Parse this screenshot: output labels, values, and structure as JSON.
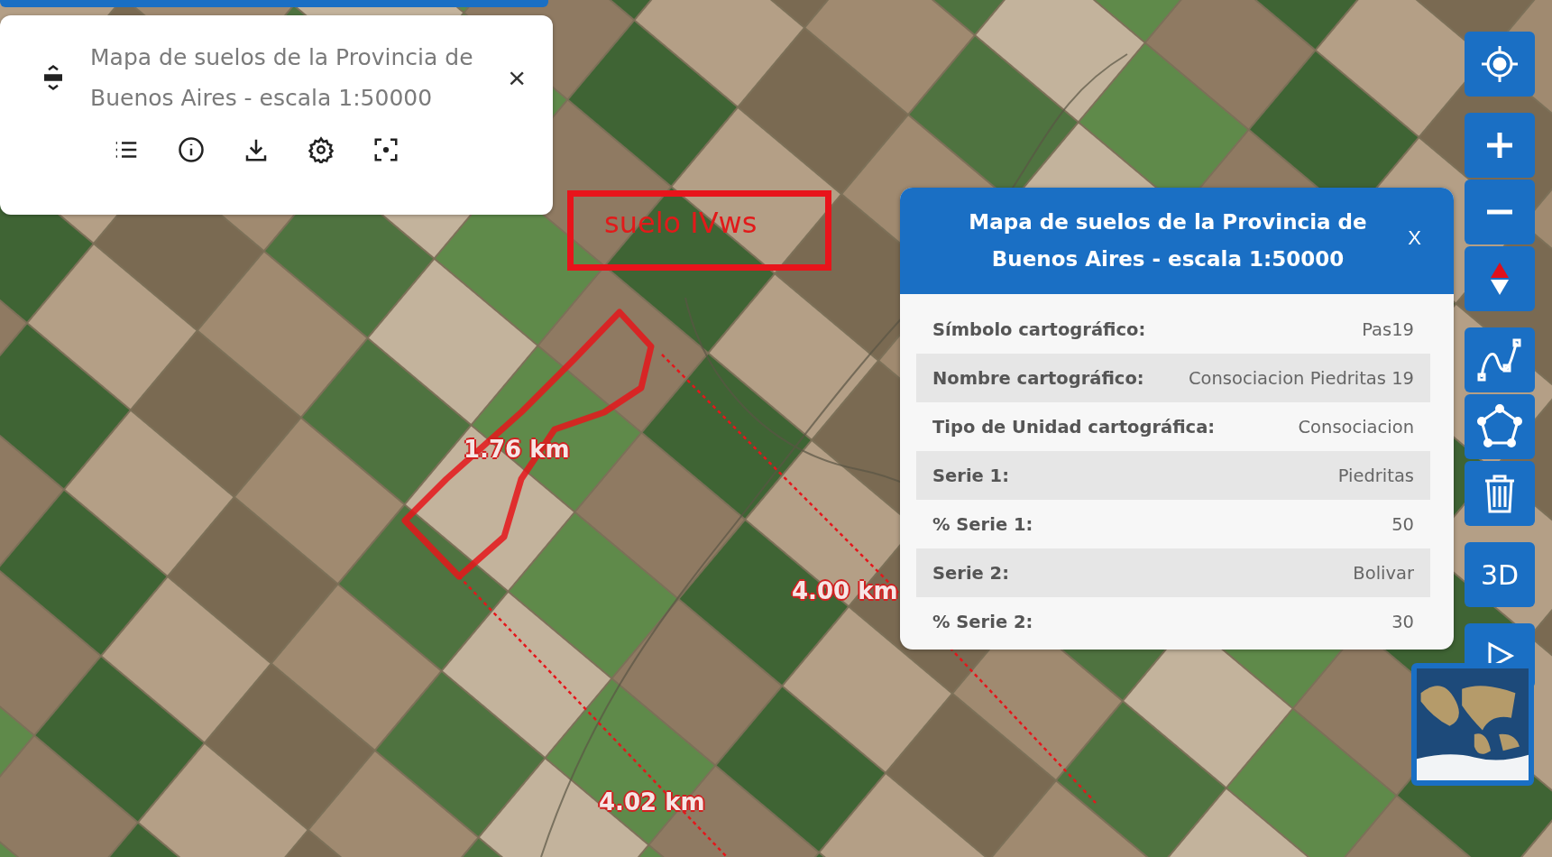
{
  "layer_panel": {
    "title": "Mapa de suelos de la Provincia de Buenos Aires - escala 1:50000",
    "close": "×"
  },
  "annotation": {
    "label": "suelo IVws"
  },
  "measurements": [
    {
      "text": "1.76 km"
    },
    {
      "text": "4.00 km"
    },
    {
      "text": "4.02 km"
    }
  ],
  "feature_popup": {
    "title": "Mapa de suelos de la Provincia de Buenos Aires - escala 1:50000",
    "close": "X",
    "rows": [
      {
        "label": "Símbolo cartográfico:",
        "value": "Pas19"
      },
      {
        "label": "Nombre cartográfico:",
        "value": "Consociacion Piedritas 19"
      },
      {
        "label": "Tipo de Unidad cartográfica:",
        "value": "Consociacion"
      },
      {
        "label": "Serie 1:",
        "value": "Piedritas"
      },
      {
        "label": "% Serie 1:",
        "value": "50"
      },
      {
        "label": "Serie 2:",
        "value": "Bolivar"
      },
      {
        "label": "% Serie 2:",
        "value": "30"
      }
    ]
  },
  "map_toolbar": {
    "view_3d": "3D"
  }
}
